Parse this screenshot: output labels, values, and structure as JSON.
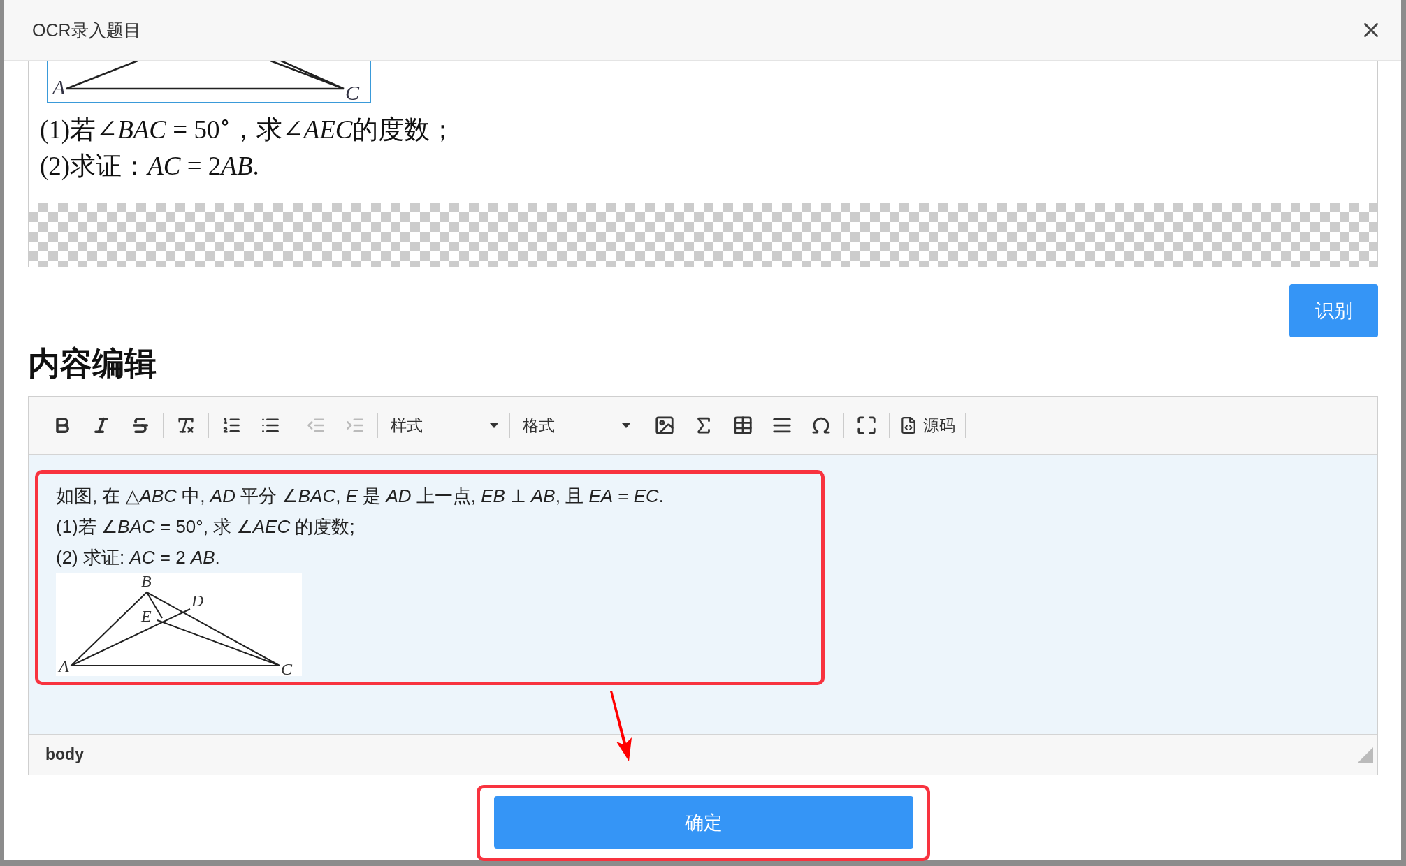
{
  "dialog": {
    "title": "OCR录入题目"
  },
  "preview": {
    "figure_labels": [
      "A",
      "C"
    ],
    "lines": [
      [
        {
          "text": "(1)若∠",
          "italic": false
        },
        {
          "text": "BAC",
          "italic": true
        },
        {
          "text": " = 50$^{∘}$，求∠",
          "italic": false
        },
        {
          "text": "AEC",
          "italic": true
        },
        {
          "text": "的度数；",
          "italic": false
        }
      ],
      [
        {
          "text": "(2)求证：",
          "italic": false
        },
        {
          "text": "AC",
          "italic": true
        },
        {
          "text": " = 2",
          "italic": false
        },
        {
          "text": "AB",
          "italic": true
        },
        {
          "text": ".",
          "italic": false
        }
      ]
    ]
  },
  "recognize_button": {
    "label": "识别"
  },
  "section_title": "内容编辑",
  "toolbar": {
    "buttons": [
      {
        "disabled": false
      },
      {
        "disabled": false
      },
      {
        "disabled": false
      },
      {
        "disabled": false
      },
      {
        "disabled": false
      },
      {
        "disabled": false
      },
      {
        "disabled": true
      },
      {
        "disabled": true
      }
    ],
    "dropdowns": [
      {
        "label": "样式"
      },
      {
        "label": "格式"
      }
    ],
    "insert_buttons": [
      {
        "disabled": false
      },
      {
        "disabled": false
      },
      {
        "disabled": false
      },
      {
        "disabled": false
      },
      {
        "disabled": false
      },
      {
        "disabled": false
      }
    ],
    "source_button": {
      "label": "源码"
    }
  },
  "editor": {
    "lines": [
      "如图, 在 △*ABC* 中, *AD* 平分 ∠*BAC*, *E* 是 *AD* 上一点, *EB* ⊥ *AB*, 且 *EA* = *EC*.",
      "(1)若 ∠*BAC* = 50°, 求 ∠*AEC* 的度数;",
      "(2) 求证:  *AC* = 2 *AB*."
    ],
    "figure_labels": [
      "A",
      "B",
      "C",
      "D",
      "E"
    ]
  },
  "status_bar": {
    "path": "body"
  },
  "confirm_button": {
    "label": "确定"
  }
}
